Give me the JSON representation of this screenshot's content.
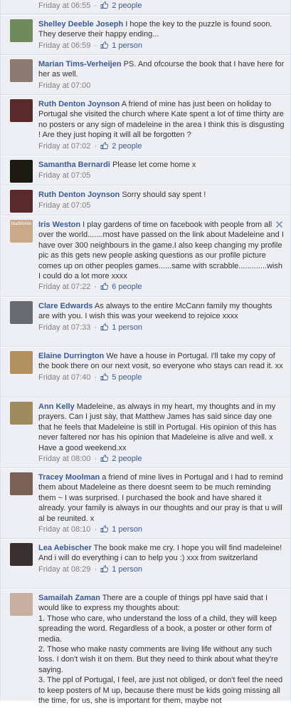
{
  "partial_top": {
    "time": "Friday at 06:55",
    "likes": "2 people"
  },
  "comments": [
    {
      "author": "Shelley Deeble Joseph",
      "text": "I hope the key to the puzzle is found soon. They deserve their happy ending...",
      "time": "Friday at 06:59",
      "likes": "1 person",
      "avatar_color": "#6f8a5c"
    },
    {
      "author": "Marian Tims-Verheijen",
      "text": "PS. And ofcourse the book that I have here for her as well.",
      "time": "Friday at 07:00",
      "likes": "",
      "avatar_color": "#8a7a70"
    },
    {
      "author": "Ruth Denton Joynson",
      "text": "A friend of mine has just been on holiday to Portugal she visited the church where Kate spent a lot of time thirty are no posters or any sign of madeleine in the area I think this is disgusting ! Are they just hoping it will all be forgotten ?",
      "time": "Friday at 07:02",
      "likes": "2 people",
      "avatar_color": "#5a2a2a"
    },
    {
      "author": "Samantha Bernardi",
      "text": "Please let come home x",
      "time": "Friday at 07:05",
      "likes": "",
      "avatar_color": "#1a1a12"
    },
    {
      "author": "Ruth Denton Joynson",
      "text": "Sorry should say spent !",
      "time": "Friday at 07:05",
      "likes": "",
      "avatar_color": "#5a2a2a"
    },
    {
      "author": "Iris Weston",
      "text": "I play gardens of time on facebook with people from all over the world.......most have passed on the link about Madeleine and I have over 300 neighbours in the game.I also keep changing my profile pic as this gets new people asking questions as our profile picture comes up on other peoples games......same with scrabble.............wish I could do a lot more xxxx",
      "time": "Friday at 07:22",
      "likes": "6 people",
      "avatar_color": "#c9a98a",
      "avatar_text": "madeleine"
    },
    {
      "author": "Clare Edwards",
      "text": "As always to the entire McCann family my thoughts are with you. I wish this was your weekend to rejoice xxxx",
      "time": "Friday at 07:33",
      "likes": "1 person",
      "avatar_color": "#6a6a72"
    },
    {
      "author": "Elaine Durrington",
      "text": "We have a house in Portugal. I'll take my copy of the book there on our next vosit, so everyone who stays can read it. xx",
      "time": "Friday at 07:40",
      "likes": "5 people",
      "avatar_color": "#b09060"
    },
    {
      "author": "Ann Kelly",
      "text": "Madeleine, as always in my heart, my thoughts and in my prayers. Can I just sày, that Matthew James has said since day one that he feels that Madeleine is still in Portugal. His opinion of this has never faltered nor has his opinion that Madeleine is alive and well. x Have a good weekend.xx",
      "time": "Friday at 08:00",
      "likes": "2 people",
      "avatar_color": "#a08a60"
    },
    {
      "author": "Tracey Moolman",
      "text": "a friend of mine lives in Portugal and I had to remind them about Madeleine as there doesnt seem to be much reminding them ~ I was surprised. I purchased the book and have shared it already. your family is always in our thoughts and our pray is that u will al be reunited. x",
      "time": "Friday at 08:10",
      "likes": "1 person",
      "avatar_color": "#7a6055"
    },
    {
      "author": "Lea Aebischer",
      "text": "The book make me cry. I hope you will find madeleine! And i will do everything i can to help you :) xxx from switzerland",
      "time": "Friday at 08:29",
      "likes": "1 person",
      "avatar_color": "#3a3030"
    },
    {
      "author": "Samailah Zaman",
      "text": "There are a couple of things ppl have said that I would like to express my thoughts about:",
      "lines": [
        "1. Those who care, who understand the loss of a child, they will keep spreading the word. Regardless of a book, a poster or other form of media.",
        "2. Those who make nasty comments are living life without any such loss. I don't wish it on them. But they need to think about what they're saying.",
        "3. The ppl of Portugal, I feel, are just not obliged, or don't feel the need to keep posters of M up, because there must be kids going missing all the time, for us, she is important for them, maybe not"
      ],
      "time": "",
      "likes": "",
      "avatar_color": "#c8b0a0"
    }
  ],
  "colors": {
    "link": "#3b5998",
    "meta": "#808080",
    "bg": "#edeff4"
  },
  "icons": {
    "like": "thumbs-up-icon",
    "close": "close-x-icon"
  }
}
